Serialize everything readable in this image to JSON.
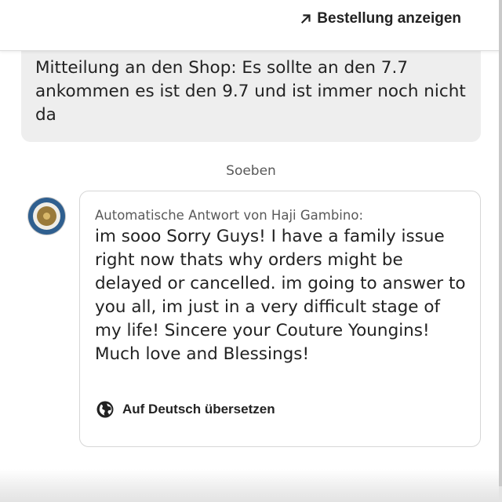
{
  "header": {
    "order_link_label": "Bestellung anzeigen",
    "order_link_icon": "arrow-up-right-icon"
  },
  "conversation": {
    "sent_message": "Mitteilung an den Shop: Es sollte an den 7.7 ankommen es ist den 9.7 und ist immer noch nicht da",
    "timestamp": "Soeben",
    "reply": {
      "avatar_icon": "shop-avatar",
      "header": "Automatische Antwort von Haji Gambino:",
      "body": "im sooo Sorry Guys! I have a family issue right now thats why orders might be delayed or cancelled. im going to answer to you all, im just in a very difficult stage of my life! Sincere your Couture Youngins! Much love and Blessings!",
      "translate_label": "Auf Deutsch übersetzen",
      "translate_icon": "globe-icon"
    }
  },
  "colors": {
    "sent_bubble_bg": "#eeeeee",
    "text_primary": "#222222",
    "text_secondary": "#595959",
    "card_border": "#d6d6d6"
  }
}
